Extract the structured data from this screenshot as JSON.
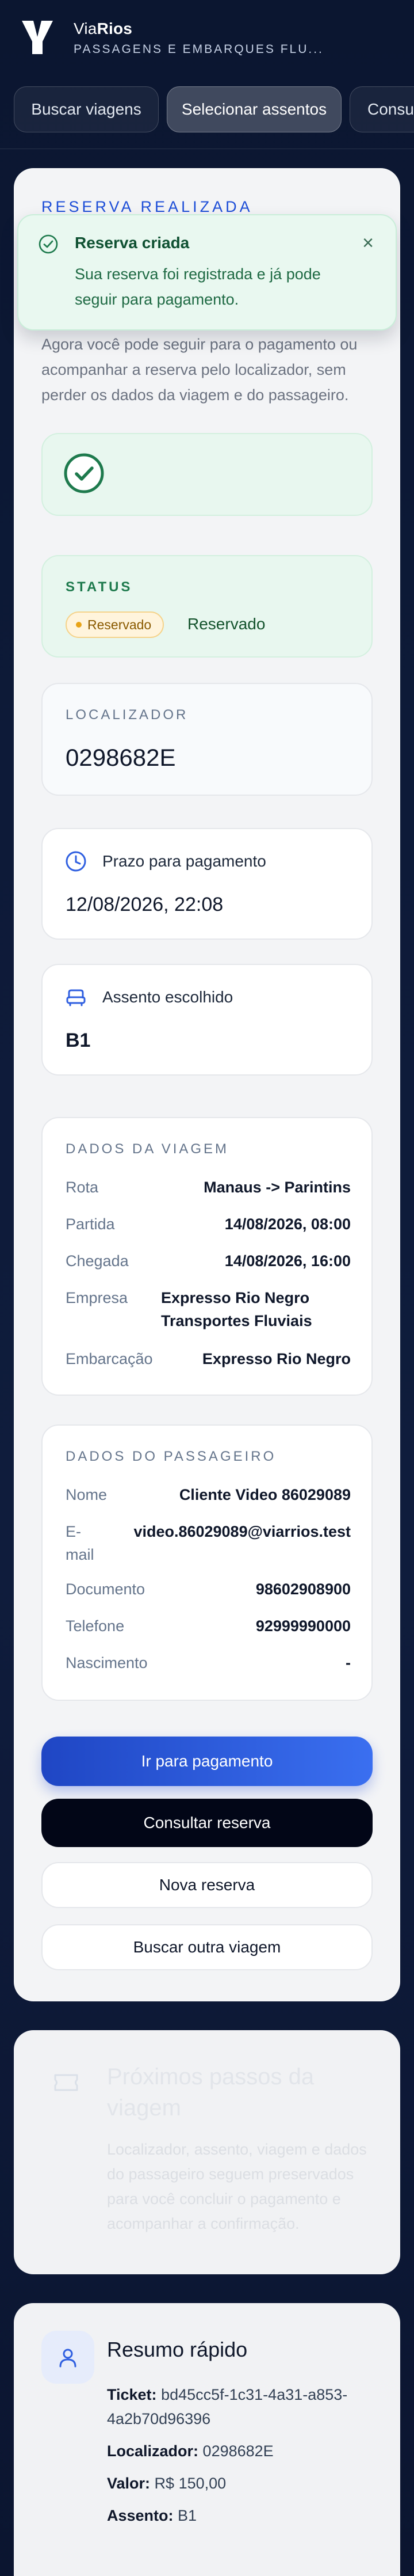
{
  "brand": {
    "name_part1": "Via",
    "name_part2": "Rios",
    "tagline": "PASSAGENS E EMBARQUES FLU..."
  },
  "steps": [
    {
      "label": "Buscar viagens",
      "active": false
    },
    {
      "label": "Selecionar assentos",
      "active": true
    },
    {
      "label": "Consu",
      "active": false
    }
  ],
  "page": {
    "eyebrow": "RESERVA REALIZADA",
    "intro": "Agora você pode seguir para o pagamento ou acompanhar a reserva pelo localizador, sem perder os dados da viagem e do passageiro."
  },
  "toast": {
    "title": "Reserva criada",
    "message": "Sua reserva foi registrada e já pode seguir para pagamento.",
    "close": "×"
  },
  "status": {
    "label": "STATUS",
    "badge": "Reservado",
    "text": "Reservado"
  },
  "locator": {
    "label": "LOCALIZADOR",
    "value": "0298682E"
  },
  "payment_deadline": {
    "title": "Prazo para pagamento",
    "value": "12/08/2026, 22:08"
  },
  "seat": {
    "title": "Assento escolhido",
    "value": "B1"
  },
  "trip": {
    "label": "DADOS DA VIAGEM",
    "rows": [
      {
        "key": "Rota",
        "value": "Manaus -> Parintins"
      },
      {
        "key": "Partida",
        "value": "14/08/2026, 08:00"
      },
      {
        "key": "Chegada",
        "value": "14/08/2026, 16:00"
      },
      {
        "key": "Empresa",
        "value": "Expresso Rio Negro Transportes Fluviais"
      },
      {
        "key": "Embarcação",
        "value": "Expresso Rio Negro"
      }
    ]
  },
  "passenger": {
    "label": "DADOS DO PASSAGEIRO",
    "rows": [
      {
        "key": "Nome",
        "value": "Cliente Video 86029089"
      },
      {
        "key": "E-mail",
        "value": "video.86029089@viarrios.test"
      },
      {
        "key": "Documento",
        "value": "98602908900"
      },
      {
        "key": "Telefone",
        "value": "92999990000"
      },
      {
        "key": "Nascimento",
        "value": "-"
      }
    ]
  },
  "buttons": {
    "pay": "Ir para pagamento",
    "lookup": "Consultar reserva",
    "new": "Nova reserva",
    "search": "Buscar outra viagem"
  },
  "next_steps": {
    "title": "Próximos passos da viagem",
    "text": "Localizador, assento, viagem e dados do passageiro seguem preservados para você concluir o pagamento e acompanhar a confirmação."
  },
  "summary": {
    "title": "Resumo rápido",
    "ticket_label": "Ticket:",
    "ticket_value": "bd45cc5f-1c31-4a31-a853-4a2b70d96396",
    "locator_label": "Localizador:",
    "locator_value": "0298682E",
    "price_label": "Valor:",
    "price_value": "R$ 150,00",
    "seat_label": "Assento:",
    "seat_value": "B1"
  },
  "colors": {
    "primary": "#2f5fe0",
    "success": "#1e7a4d",
    "warning": "#e8a317",
    "dark": "#020617"
  },
  "icons": [
    "v-logo",
    "check-circle-icon",
    "close-icon",
    "clock-icon",
    "seat-icon",
    "ticket-icon",
    "user-icon"
  ]
}
